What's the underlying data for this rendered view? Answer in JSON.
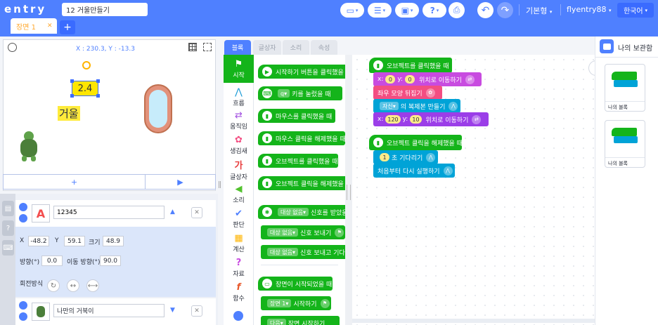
{
  "header": {
    "logo": "entry",
    "project_title": "12 거울만들기",
    "mode_label": "기본형",
    "user_label": "flyentry88",
    "language_label": "한국어"
  },
  "scene": {
    "tab_label": "장면 1",
    "close_glyph": "✕",
    "add_glyph": "+"
  },
  "stage": {
    "coords": "X : 230.3, Y : -13.3",
    "sprite_text": "거울",
    "sprite_selected_text": "2.4",
    "add_glyph": "+",
    "play_glyph": "▶"
  },
  "objects": [
    {
      "icon_letter": "A",
      "name": "12345",
      "x_label": "X",
      "x_value": "-48.2",
      "y_label": "Y",
      "y_value": "59.1",
      "size_label": "크기",
      "size_value": "48.9",
      "direction_label": "방향(°)",
      "direction_value": "0.0",
      "move_direction_label": "이동 방향(°)",
      "move_direction_value": "90.0",
      "rotation_label": "회전방식"
    },
    {
      "name": "나만의 거북이"
    }
  ],
  "palette_tabs": [
    "블록",
    "글상자",
    "소리",
    "속성"
  ],
  "categories": [
    {
      "label": "시작",
      "icon": "flag-icon"
    },
    {
      "label": "흐름",
      "icon": "flow-icon"
    },
    {
      "label": "움직임",
      "icon": "move-icon"
    },
    {
      "label": "생김새",
      "icon": "looks-icon"
    },
    {
      "label": "글상자",
      "icon": "text-icon"
    },
    {
      "label": "소리",
      "icon": "sound-icon"
    },
    {
      "label": "판단",
      "icon": "judge-icon"
    },
    {
      "label": "계산",
      "icon": "calc-icon"
    },
    {
      "label": "자료",
      "icon": "data-icon"
    },
    {
      "label": "함수",
      "icon": "function-icon"
    }
  ],
  "palette_blocks": {
    "b1": "시작하기 버튼을 클릭했을 때",
    "b2_key": "q",
    "b2": "키를 눌렀을 때",
    "b3": "마우스를 클릭했을 때",
    "b4": "마우스 클릭을 해제했을 때",
    "b5": "오브젝트를 클릭했을 때",
    "b6": "오브젝트 클릭을 해제했을 때",
    "b7_target": "대상 없음",
    "b7": "신호를 받았을 때",
    "b8_target": "대상 없음",
    "b8": "신호 보내기",
    "b9_target": "대상 없음",
    "b9": "신호 보내고 기다리기",
    "b10": "장면이 시작되었을 때",
    "b11_target": "장면 1",
    "b11": "시작하기",
    "b12_target": "다음",
    "b12": "장면 시작하기"
  },
  "script1": {
    "hat": "오브젝트를 클릭했을 때",
    "s1_x": "0",
    "s1_y": "0",
    "s1_text": "위치로 이동하기",
    "s2_text": "좌우 모양 뒤집기",
    "s3_target": "자신",
    "s3_text": "의 복제본 만들기",
    "s4_x": "120",
    "s4_y": "10",
    "s4_text": "위치로 이동하기"
  },
  "script2": {
    "hat": "오브젝트 클릭을 해제했을 때",
    "s1_val": "1",
    "s1_text": "초 기다리기",
    "s2_text": "처음부터 다시 실행하기"
  },
  "locker": {
    "title": "나의 보관함",
    "card1_label": "나의 블록",
    "card2_label": "나의 블록"
  },
  "labels": {
    "x": "x:",
    "y": "y:"
  }
}
